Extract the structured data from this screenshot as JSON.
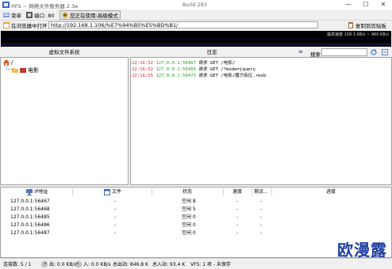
{
  "window": {
    "title": "HFS ~ 网络文件服务器 2.3e",
    "build": "Build 293",
    "controls": {
      "minimize": "—",
      "maximize": "☐",
      "close": "✕"
    }
  },
  "toolbar": {
    "menu_label": "菜单",
    "port_label": "端口: 80",
    "mode_label": "您正在使用:高级模式"
  },
  "urlbar": {
    "open_label": "在浏览器中打开",
    "url": "http://192.168.1.106/%E7%94%B5%E5%BD%B1/",
    "copy_label": "复制到剪贴板"
  },
  "graph": {
    "speed_text": "最高速度 108.3 KB/s ~ 960 KB/s"
  },
  "vfs": {
    "header": "虚拟文件系统",
    "root": "/",
    "children": [
      "电影"
    ]
  },
  "log": {
    "header": "日志",
    "search_label": "搜索",
    "search_value": "",
    "lines": [
      {
        "time": "22:16:52",
        "ip": "127.0.0.1:56467",
        "text": "请求 GET /电影/"
      },
      {
        "time": "22:16:52",
        "ip": "127.0.0.1:56468",
        "text": "请求 GET /?mode=jquery"
      },
      {
        "time": "22:16:55",
        "ip": "127.0.0.1:56473",
        "text": "请求 GET /电影/魔力街区.rmvb"
      }
    ]
  },
  "transfers": {
    "columns": [
      "IP地址",
      "文件",
      "状态",
      "速度",
      "剩余...",
      "进度"
    ],
    "rows": [
      {
        "ip": "127.0.0.1:56467",
        "file": "-",
        "status": "空闲 8",
        "speed": "-",
        "remaining": "-"
      },
      {
        "ip": "127.0.0.1:56468",
        "file": "-",
        "status": "空闲 5",
        "speed": "-",
        "remaining": "-"
      },
      {
        "ip": "127.0.0.1:56485",
        "file": "-",
        "status": "空闲 0",
        "speed": "-",
        "remaining": "-"
      },
      {
        "ip": "127.0.0.1:56486",
        "file": "-",
        "status": "空闲 0",
        "speed": "-",
        "remaining": "-"
      },
      {
        "ip": "127.0.0.1:56487",
        "file": "-",
        "status": "空闲 0",
        "speed": "-",
        "remaining": "-"
      }
    ]
  },
  "status": {
    "connections": "连接数: 5 / 1",
    "out_speed": "出: 0.0 KB/s",
    "in_speed": "入: 0.0 KB/s",
    "total_out": "总出站: 846.8 K",
    "total_in": "总入站: 93.4 K",
    "vfs": "VFS: 1 项 - 未保存"
  },
  "watermark": "欧漫露",
  "colors": {
    "log_time": "#e22a2a",
    "log_ip": "#2a9d2a",
    "graph_bg": "#000000",
    "watermark": "#1f3fa0"
  }
}
